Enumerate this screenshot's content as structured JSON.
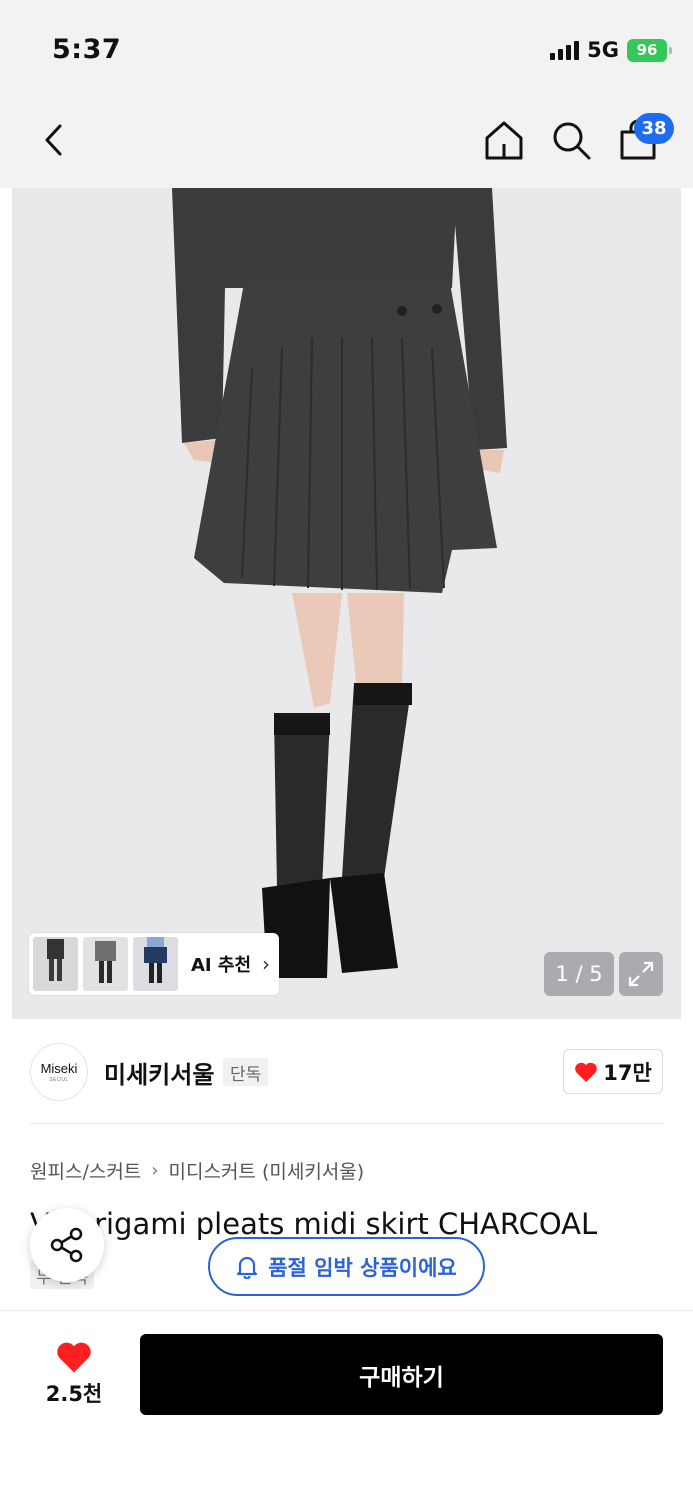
{
  "status": {
    "time": "5:37",
    "network": "5G",
    "battery": "96"
  },
  "nav": {
    "cart_count": "38"
  },
  "gallery": {
    "counter": "1 / 5",
    "ai_label": "AI 추천",
    "chevron": "›"
  },
  "brand": {
    "logo_text": "Miseki",
    "logo_sub": "SEOUL",
    "name": "미세키서울",
    "badge": "단독",
    "likes": "17만"
  },
  "breadcrumb": {
    "category": "원피스/스커트",
    "separator": "›",
    "subcategory": "미디스커트 (미세키서울)"
  },
  "product": {
    "title": "V    i origami pleats midi skirt CHARCOAL",
    "badge": "무  단독"
  },
  "alert": {
    "soldout_text": "품절 임박 상품이에요"
  },
  "bottom": {
    "wish_count": "2.5천",
    "buy_label": "구매하기"
  },
  "colors": {
    "accent": "#1f6cf3",
    "alert_blue": "#2a63d8",
    "heart": "#ff1f1f",
    "buy_bg": "#000000"
  }
}
